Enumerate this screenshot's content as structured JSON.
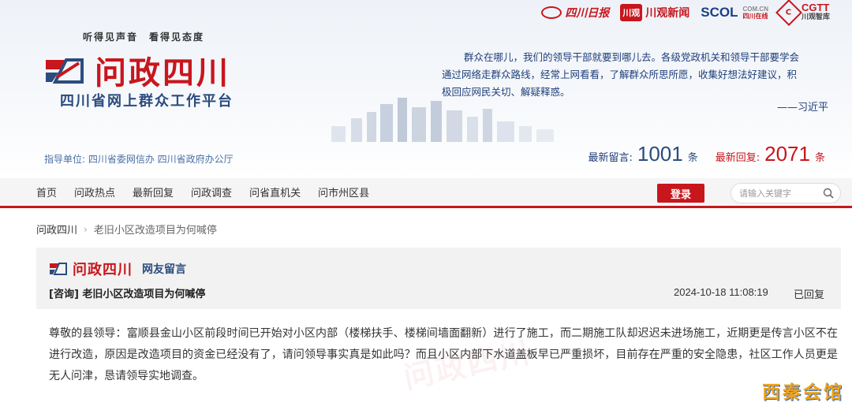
{
  "header": {
    "slogan": "听得见声音　看得见态度",
    "brand_title": "问政四川",
    "brand_subtitle": "四川省网上群众工作平台",
    "guide": "指导单位: 四川省委网信办 四川省政府办公厅",
    "quote_line1": "群众在哪儿，我们的领导干部就要到哪儿去。各级党政机关和领导干部要学会",
    "quote_line2": "通过网络走群众路线，经常上网看看，了解群众所思所愿，收集好想法好建议，积",
    "quote_line3": "极回应网民关切、解疑释惑。",
    "quote_author": "——习近平",
    "partners": {
      "sichuan_daily": "四川日报",
      "chuanguan_badge": "川观",
      "chuanguan_news": "川观新闻",
      "scol": "SCOL",
      "scol_domain": "COM.CN",
      "scol_cn": "四川在线",
      "cgtt_logo": "C",
      "cgtt": "CGTT",
      "cgtt_sub": "川观智库"
    },
    "stats": {
      "latest_messages_label": "最新留言:",
      "latest_messages_count": "1001",
      "latest_messages_unit": "条",
      "latest_replies_label": "最新回复:",
      "latest_replies_count": "2071",
      "latest_replies_unit": "条"
    }
  },
  "nav": {
    "items": [
      "首页",
      "问政热点",
      "最新回复",
      "问政调查",
      "问省直机关",
      "问市州区县"
    ],
    "login": "登录",
    "search_placeholder": "请输入关键字"
  },
  "breadcrumb": {
    "home": "问政四川",
    "separator": "›",
    "current": "老旧小区改造项目为何喊停"
  },
  "post": {
    "brand": "问政四川",
    "tag": "网友留言",
    "title": "[咨询] 老旧小区改造项目为何喊停",
    "time": "2024-10-18 11:08:19",
    "status": "已回复",
    "body": "尊敬的县领导：富顺县金山小区前段时间已开始对小区内部（楼梯扶手、楼梯间墙面翻新）进行了施工，而二期施工队却迟迟未进场施工，近期更是传言小区不在进行改造，原因是改造项目的资金已经没有了，请问领导事实真是如此吗？而且小区内部下水道盖板早已严重损坏，目前存在严重的安全隐患，社区工作人员更是无人问津，恳请领导实地调查。"
  },
  "watermark": "问政四川",
  "corner_mark": "西秦会馆",
  "colors": {
    "brand_red": "#c8161d",
    "brand_blue": "#2b4c7e"
  }
}
